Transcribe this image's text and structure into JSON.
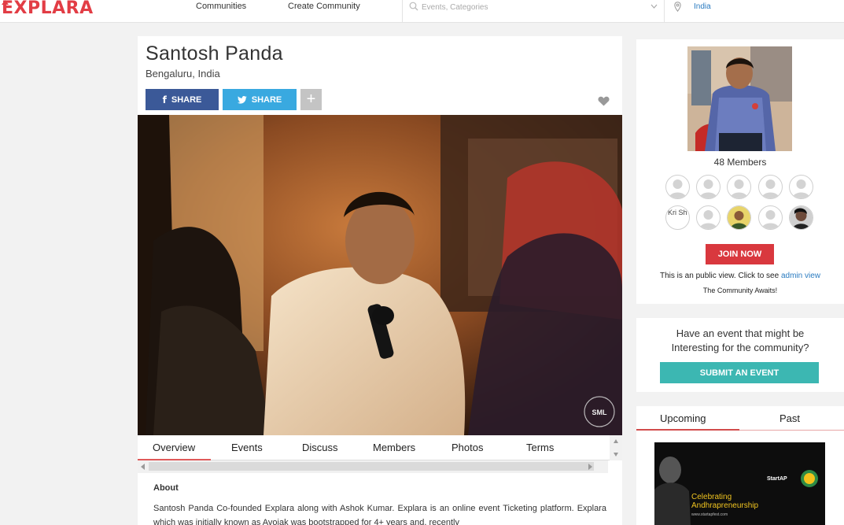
{
  "topbar": {
    "logo": "EXPLARA",
    "nav": [
      "Communities",
      "Create Community"
    ],
    "search_placeholder": "Events, Categories",
    "location": "India"
  },
  "profile": {
    "name": "Santosh Panda",
    "location": "Bengaluru, India",
    "share_facebook": "SHARE",
    "share_twitter": "SHARE",
    "more": "+"
  },
  "tabs": [
    "Overview",
    "Events",
    "Discuss",
    "Members",
    "Photos",
    "Terms"
  ],
  "about": {
    "heading": "About",
    "text": "Santosh Panda Co-founded Explara along with Ashok Kumar. Explara is an online event Ticketing platform. Explara which was initially known as Avojak was bootstrapped for 4+ years and, recently"
  },
  "photo": {
    "watermark": "SML"
  },
  "sidebar": {
    "members_count": "48 Members",
    "member_avatar_alt": "Kri Sh",
    "join_label": "JOIN NOW",
    "public_view_text": "This is an public view. Click to see",
    "admin_view_link": "admin view",
    "awaits_text": "The Community Awaits!",
    "event_question_line1": "Have an event that might be",
    "event_question_line2": "Interesting for the community?",
    "submit_label": "SUBMIT AN EVENT",
    "upcoming_tab": "Upcoming",
    "past_tab": "Past",
    "banner_line1": "Celebrating",
    "banner_line2": "Andhrapreneurship",
    "banner_url": "www.startapfest.com",
    "banner_brand": "StartAP"
  },
  "colors": {
    "brand": "#e23d45",
    "facebook": "#3b5998",
    "twitter": "#39a9e0",
    "join": "#d9383e",
    "submit": "#3cb7b2",
    "link": "#2a7bc0"
  }
}
